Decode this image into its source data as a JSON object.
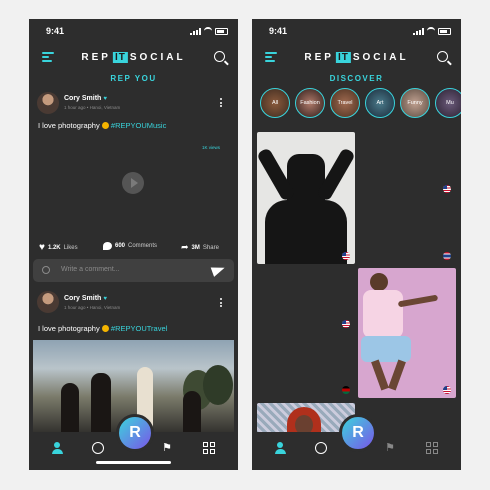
{
  "status": {
    "time": "9:41"
  },
  "logo": {
    "left": "REP",
    "mid": "IT",
    "right": "SOCIAL"
  },
  "screen1": {
    "title": "REP YOU",
    "posts": [
      {
        "user": "Cory Smith",
        "meta": "1 hour ago • Hanoi, Vietnam",
        "caption_text": "I love photography",
        "caption_tag": "#REPYOUMusic",
        "views": "1K views"
      },
      {
        "user": "Cory Smith",
        "meta": "1 hour ago • Hanoi, Vietnam",
        "caption_text": "I love photography",
        "caption_tag": "#REPYOUTravel"
      }
    ],
    "likes": "1.2K",
    "likes_label": "Likes",
    "comments": "600",
    "comments_label": "Comments",
    "shares": "3M",
    "shares_label": "Share",
    "comment_placeholder": "Write a comment..."
  },
  "screen2": {
    "title": "DISCOVER",
    "stories": [
      "All",
      "Fashion",
      "Travel",
      "Art",
      "Funny",
      "Mu"
    ]
  },
  "fab_letter": "R",
  "colors": {
    "accent": "#39d4dc",
    "background": "#2d2d2d",
    "fab_end": "#7a55e8"
  }
}
